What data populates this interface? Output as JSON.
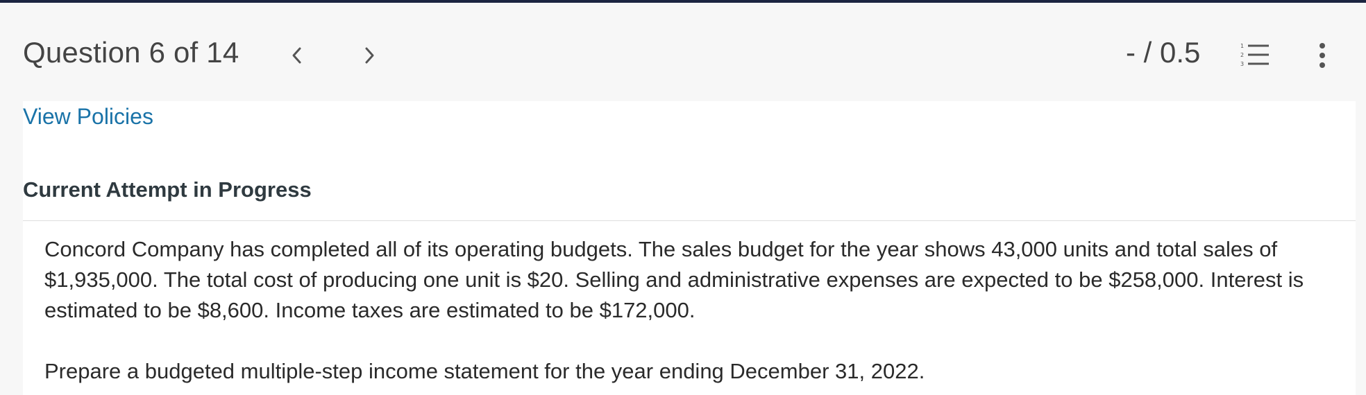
{
  "header": {
    "question_label": "Question 6 of 14",
    "score": "- / 0.5",
    "icons": {
      "prev": "chevron-left-icon",
      "next": "chevron-right-icon",
      "list": "numbered-list-icon",
      "more": "more-vertical-icon"
    },
    "accent_color": "#1c2541"
  },
  "content": {
    "view_policies_link": "View Policies",
    "attempt_heading": "Current Attempt in Progress",
    "question_text": "Concord Company has completed all of its operating budgets. The sales budget for the year shows 43,000 units and total sales of $1,935,000. The total cost of producing one unit is $20. Selling and administrative expenses are expected to be $258,000. Interest is estimated to be $8,600. Income taxes are estimated to be $172,000.",
    "instruction_text": "Prepare a budgeted multiple-step income statement for the year ending December 31, 2022.",
    "link_color": "#1a73a8"
  }
}
